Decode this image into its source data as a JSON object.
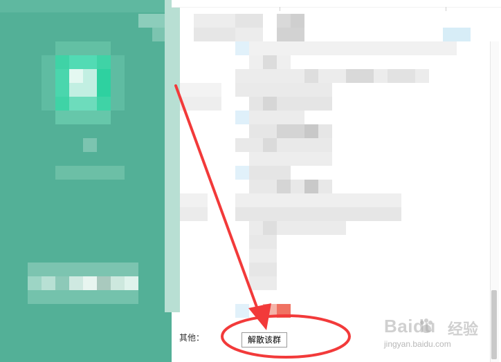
{
  "form": {
    "other_label": "其他：",
    "dismiss_group_button": "解散该群"
  },
  "watermark": {
    "brand": "Baidu",
    "product": "经验",
    "url": "jingyan.baidu.com"
  },
  "colors": {
    "panel_green": "#53b097",
    "accent_teal": "#2fd6a6",
    "annotation_red": "#f23a3a"
  },
  "icons": {
    "avatar": "group-avatar-icon",
    "paw": "baidu-paw-icon",
    "arrow": "annotation-arrow",
    "circle": "annotation-circle"
  }
}
